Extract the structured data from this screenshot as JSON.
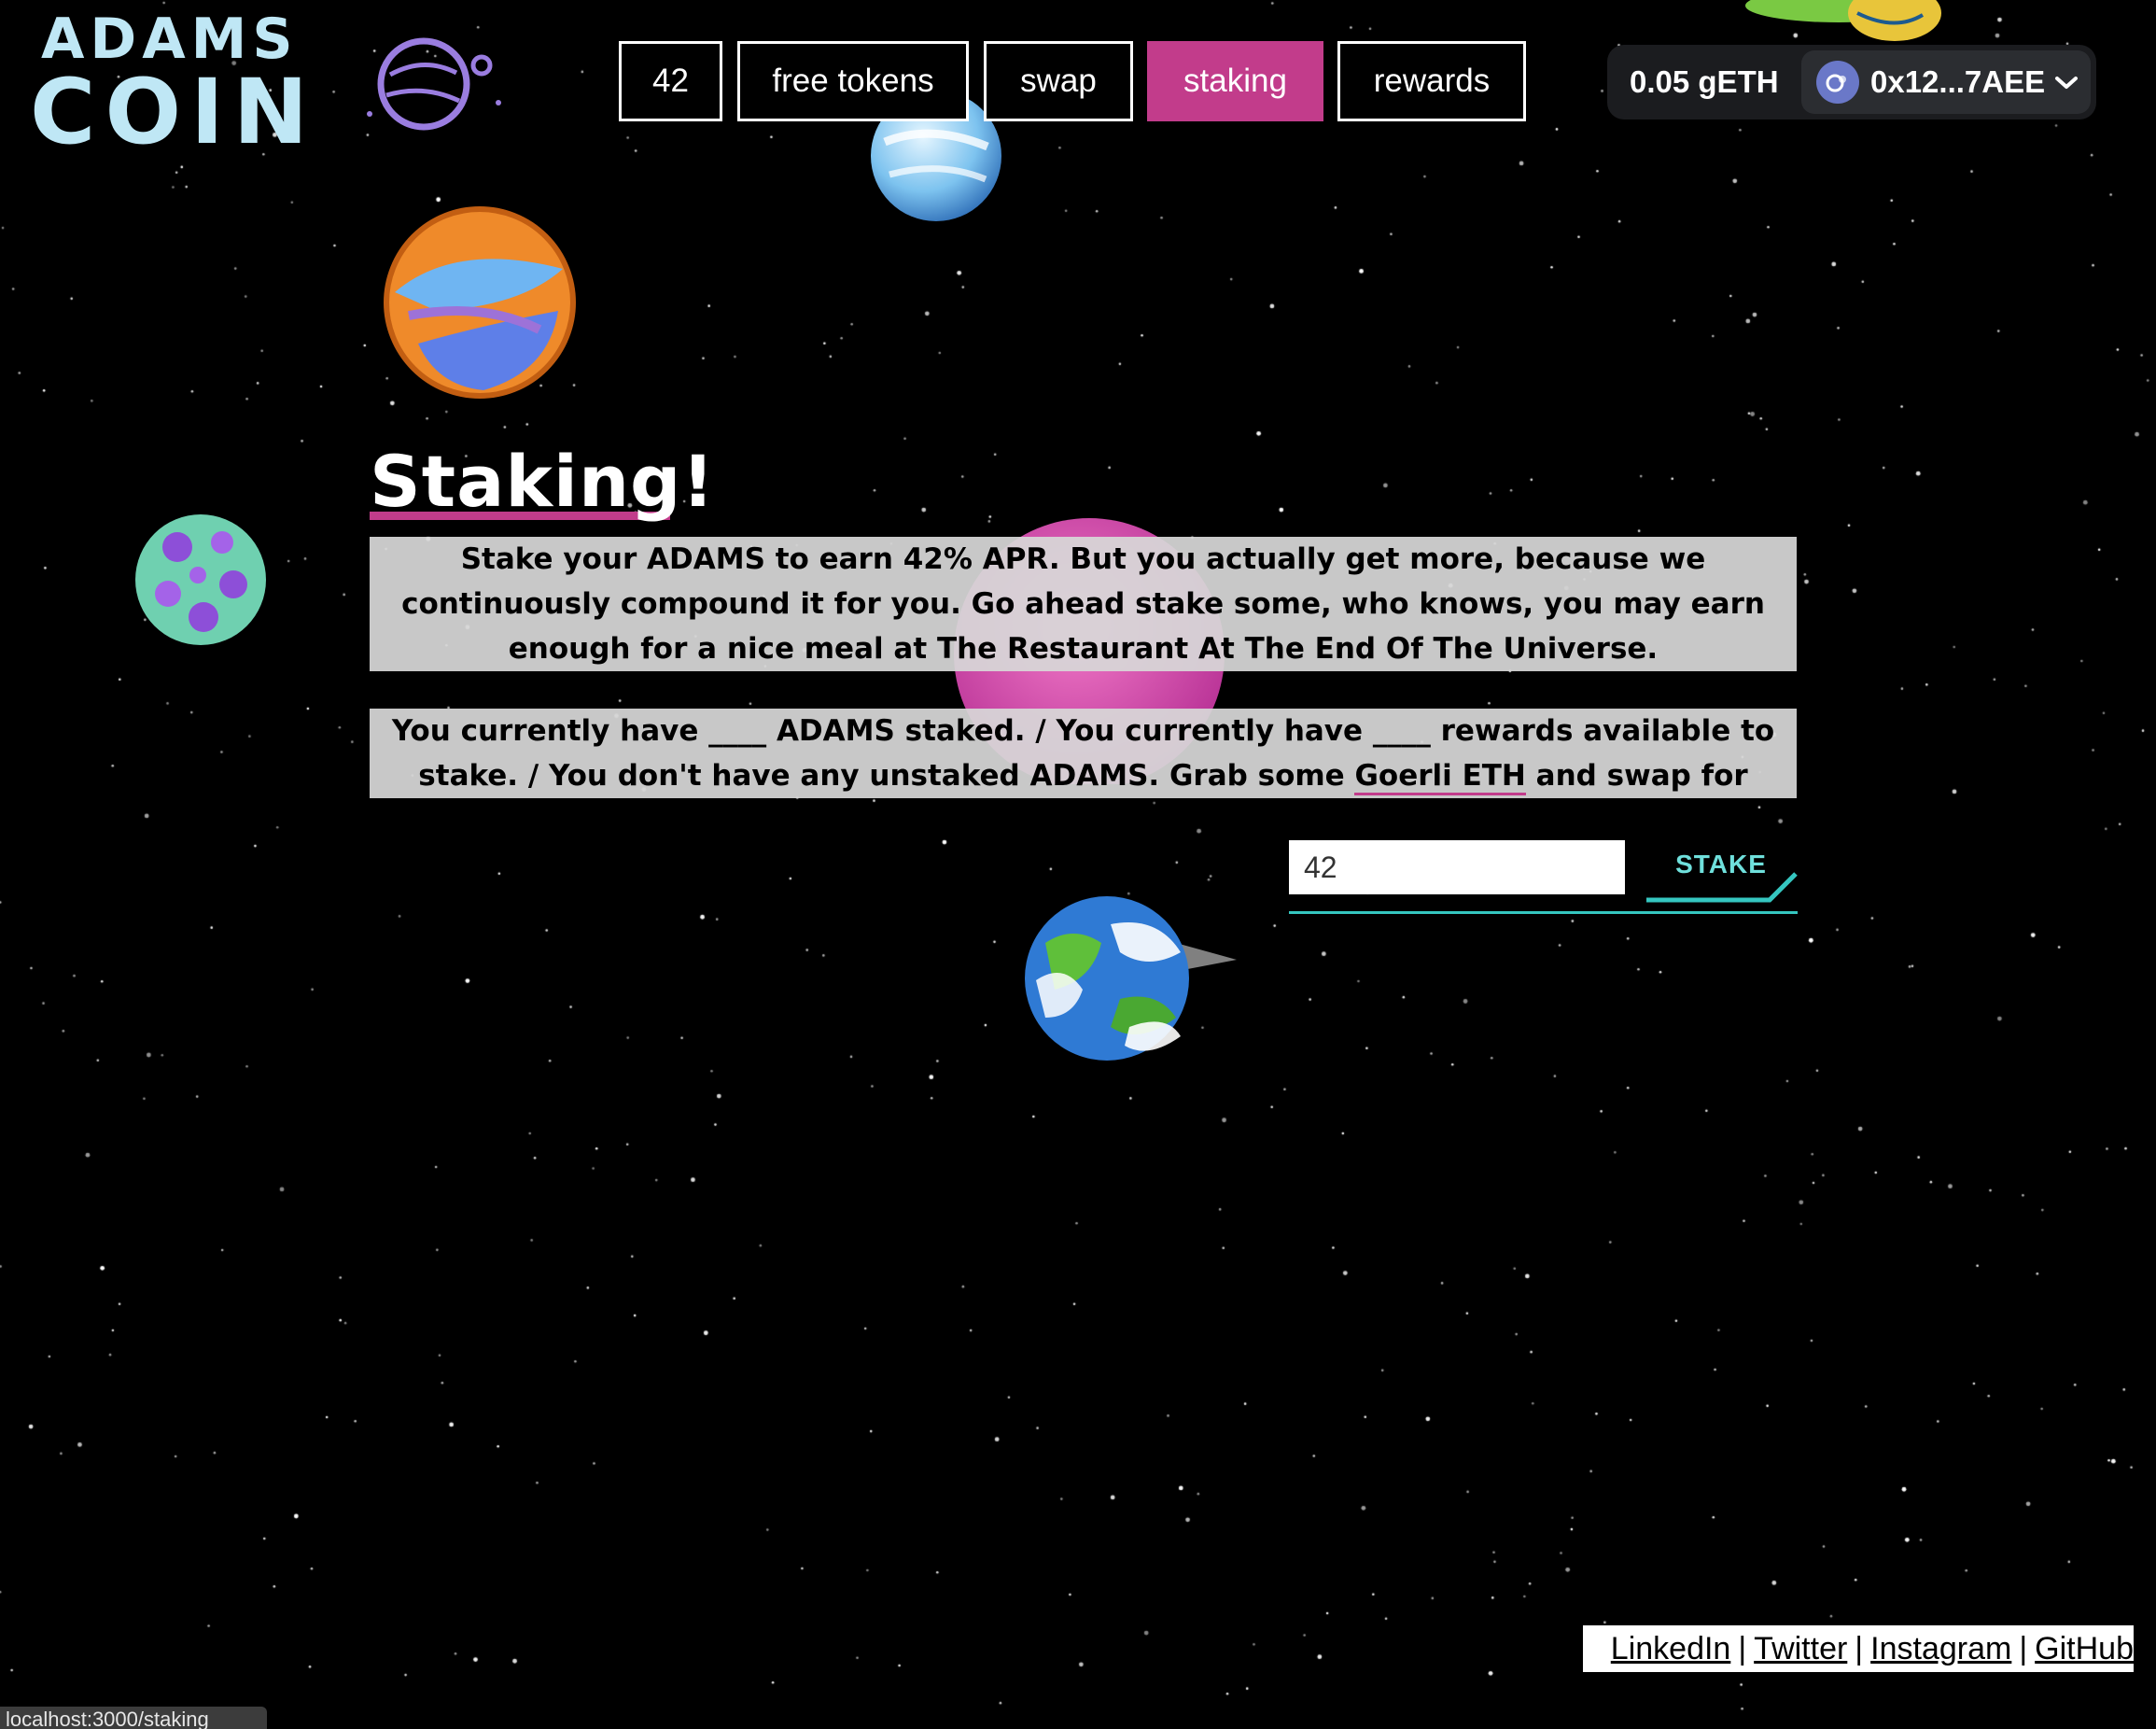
{
  "logo": {
    "line1": "ADAMS",
    "line2": "COIN"
  },
  "nav": {
    "items": [
      {
        "label": "42",
        "active": false
      },
      {
        "label": "free tokens",
        "active": false
      },
      {
        "label": "swap",
        "active": false
      },
      {
        "label": "staking",
        "active": true
      },
      {
        "label": "rewards",
        "active": false
      }
    ]
  },
  "wallet": {
    "balance": "0.05 gETH",
    "address": "0x12...7AEE"
  },
  "main": {
    "title": "Staking!",
    "intro": "Stake your ADAMS to earn 42% APR. But you actually get more, because we continuously compound it for you. Go ahead stake some, who knows, you may earn enough for a nice meal at The Restaurant At The End Of The Universe.",
    "status_before_link": "You currently have ____ ADAMS staked. / You currently have ____ rewards available to stake. / You don't have any unstaked ADAMS. Grab some ",
    "status_link": "Goerli ETH",
    "status_after_link": " and swap for ADAMS first.",
    "stake_input_value": "42",
    "stake_button": "STAKE"
  },
  "footer": {
    "links": [
      "LinkedIn",
      "Twitter",
      "Instagram",
      "GitHub"
    ],
    "separator": "|"
  },
  "statusbar": {
    "url": "localhost:3000/staking"
  },
  "colors": {
    "accent": "#c23c8b",
    "logo": "#bfe7f5",
    "stake": "#35c6c0",
    "background": "#000000"
  }
}
